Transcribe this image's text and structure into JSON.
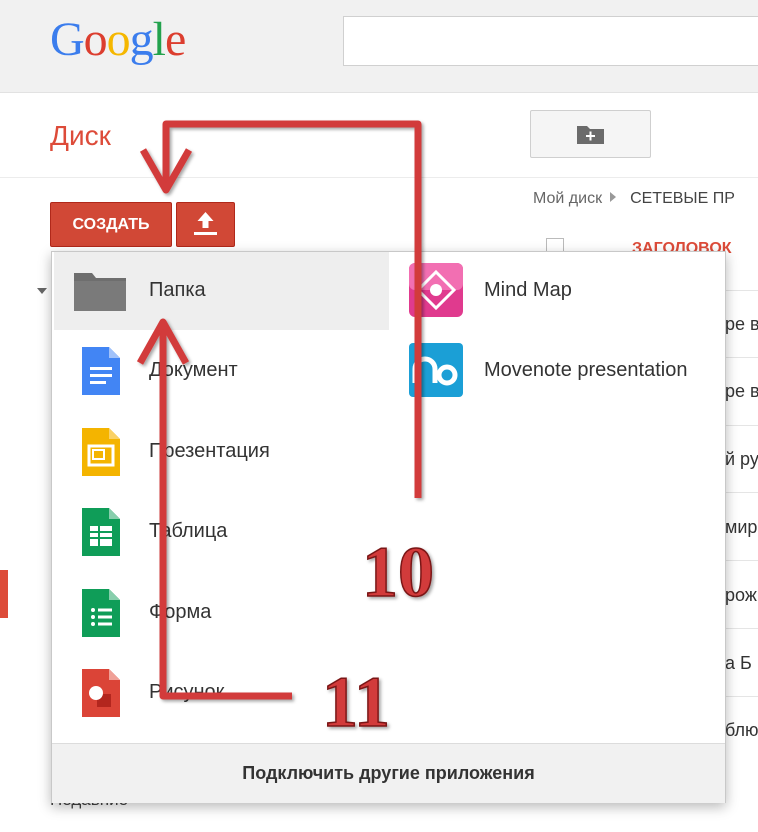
{
  "header": {
    "logo_text": "Google"
  },
  "subheader": {
    "title": "Диск"
  },
  "breadcrumb": {
    "root": "Мой диск",
    "current": "СЕТЕВЫЕ ПР"
  },
  "toolbar": {
    "create_label": "СОЗДАТЬ"
  },
  "list": {
    "header_title": "ЗАГОЛОВОК",
    "row_fragments": [
      "ре в",
      "ре в",
      "й ру",
      "мир",
      "рож",
      "а Б",
      "блю"
    ],
    "left_label": "Недавние"
  },
  "menu": {
    "items_left": [
      {
        "label": "Папка",
        "icon": "folder-icon"
      },
      {
        "label": "Документ",
        "icon": "document-icon"
      },
      {
        "label": "Презентация",
        "icon": "presentation-icon"
      },
      {
        "label": "Таблица",
        "icon": "spreadsheet-icon"
      },
      {
        "label": "Форма",
        "icon": "form-icon"
      },
      {
        "label": "Рисунок",
        "icon": "drawing-icon"
      }
    ],
    "items_right": [
      {
        "label": "Mind Map",
        "icon": "mindmap-app-icon"
      },
      {
        "label": "Movenote presentation",
        "icon": "movenote-app-icon"
      }
    ],
    "footer_label": "Подключить другие приложения"
  },
  "annotations": {
    "step_a": "10",
    "step_b": "11"
  },
  "colors": {
    "accent": "#dd4b39",
    "button_red": "#d14836",
    "annotation_red": "#d23a3a",
    "docs_blue": "#4285f4",
    "slides_yellow": "#f4b400",
    "sheets_green": "#0f9d58"
  }
}
